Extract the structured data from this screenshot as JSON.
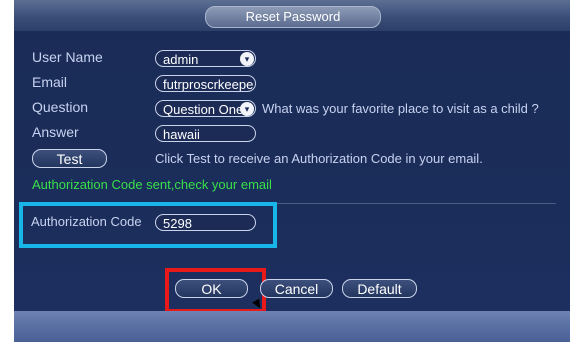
{
  "dialog": {
    "title": "Reset Password"
  },
  "form": {
    "user_name": {
      "label": "User Name",
      "value": "admin"
    },
    "email": {
      "label": "Email",
      "value": "futrproscrkeepe"
    },
    "question": {
      "label": "Question",
      "value": "Question One",
      "text": "What was your favorite place to visit as a child ?"
    },
    "answer": {
      "label": "Answer",
      "value": "hawaii"
    },
    "test": {
      "button_label": "Test",
      "hint": "Click Test to receive an Authorization Code in your email."
    },
    "status": "Authorization  Code sent,check your email",
    "auth_code": {
      "label": "Authorization  Code",
      "value": "5298"
    }
  },
  "buttons": {
    "ok": "OK",
    "cancel": "Cancel",
    "default": "Default"
  },
  "colors": {
    "status_green": "#38e04a",
    "highlight_blue": "#18b6e8",
    "highlight_red": "#e81919"
  },
  "icons": {
    "dropdown": "chevron-down-icon"
  }
}
